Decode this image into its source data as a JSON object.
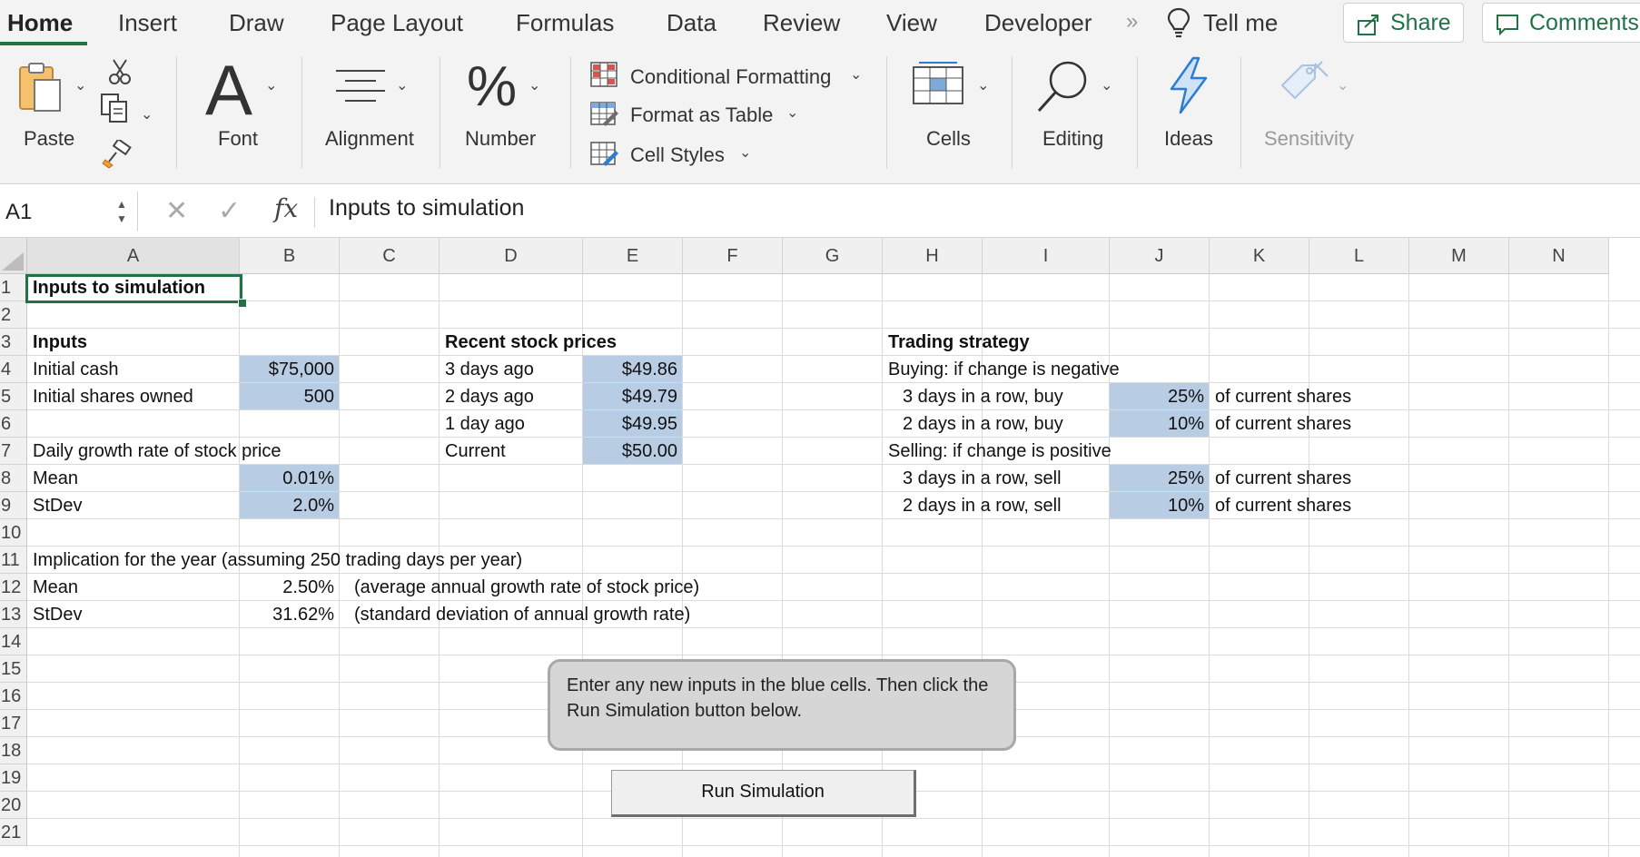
{
  "ribbon_tabs": [
    {
      "label": "Home",
      "active": true
    },
    {
      "label": "Insert"
    },
    {
      "label": "Draw"
    },
    {
      "label": "Page Layout"
    },
    {
      "label": "Formulas"
    },
    {
      "label": "Data"
    },
    {
      "label": "Review"
    },
    {
      "label": "View"
    },
    {
      "label": "Developer"
    }
  ],
  "tell_me": "Tell me",
  "share_label": "Share",
  "comments_label": "Comments",
  "ribbon": {
    "paste": "Paste",
    "font": "Font",
    "font_glyph": "A",
    "alignment": "Alignment",
    "number": "Number",
    "number_glyph": "%",
    "conditional_formatting": "Conditional Formatting",
    "format_as_table": "Format as Table",
    "cell_styles": "Cell Styles",
    "cells": "Cells",
    "editing": "Editing",
    "ideas": "Ideas",
    "sensitivity": "Sensitivity"
  },
  "formula_bar": {
    "name_box": "A1",
    "fx": "fx",
    "formula": "Inputs to simulation"
  },
  "columns": [
    "A",
    "B",
    "C",
    "D",
    "E",
    "F",
    "G",
    "H",
    "I",
    "J",
    "K",
    "L",
    "M",
    "N"
  ],
  "rows": [
    "1",
    "2",
    "3",
    "4",
    "5",
    "6",
    "7",
    "8",
    "9",
    "10",
    "11",
    "12",
    "13",
    "14",
    "15",
    "16",
    "17",
    "18",
    "19",
    "20",
    "21"
  ],
  "cells": {
    "A1": "Inputs to simulation",
    "A3": "Inputs",
    "A4": "Initial cash",
    "B4": "$75,000",
    "A5": "Initial shares owned",
    "B5": "500",
    "A7": "Daily growth rate of stock price",
    "A8": "Mean",
    "B8": "0.01%",
    "A9": "StDev",
    "B9": "2.0%",
    "A11": "Implication for the year (assuming 250 trading days per year)",
    "A12": "Mean",
    "B12": "2.50%",
    "C12": "(average annual growth rate of stock price)",
    "A13": "StDev",
    "B13": "31.62%",
    "C13": "(standard deviation of annual growth rate)",
    "D3": "Recent stock prices",
    "D4": "3 days ago",
    "E4": "$49.86",
    "D5": "2 days ago",
    "E5": "$49.79",
    "D6": "1 day ago",
    "E6": "$49.95",
    "D7": "Current",
    "E7": "$50.00",
    "H3": "Trading strategy",
    "H4": "Buying: if change is negative",
    "H5": "3 days in a row, buy",
    "J5": "25%",
    "K5": "of current shares",
    "H6": "2 days in a row, buy",
    "J6": "10%",
    "K6": "of current shares",
    "H7": "Selling: if change is positive",
    "H8": "3 days in a row, sell",
    "J8": "25%",
    "K8": "of current shares",
    "H9": "2 days in a row, sell",
    "J9": "10%",
    "K9": "of current shares"
  },
  "note_text": "Enter any new inputs in the blue cells. Then click the Run Simulation button below.",
  "run_button": "Run Simulation",
  "colors": {
    "accent": "#217346",
    "input_cell_fill": "#b8cce4",
    "ideas_icon": "#2b7cd3"
  }
}
